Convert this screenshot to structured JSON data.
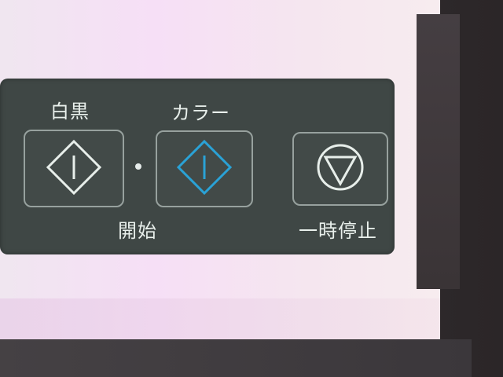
{
  "panel": {
    "mono_label": "白黒",
    "color_label": "カラー",
    "start_label": "開始",
    "pause_label": "一時停止"
  },
  "icons": {
    "mono_start": "diamond-start-icon",
    "color_start": "diamond-start-icon",
    "stop": "triangle-in-circle-stop-icon"
  },
  "colors": {
    "panel_bg": "#3f4745",
    "label_text": "#e9f0ec",
    "color_accent": "#2aa2d6",
    "paper_pink": "#f6dff6"
  }
}
